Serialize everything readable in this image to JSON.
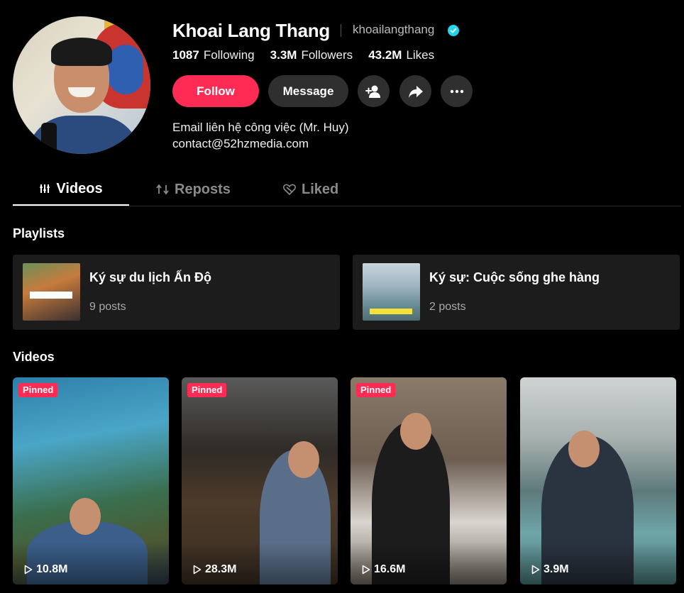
{
  "profile": {
    "name": "Khoai Lang Thang",
    "handle": "khoailangthang",
    "verified": true,
    "stats": [
      {
        "value": "1087",
        "label": "Following"
      },
      {
        "value": "3.3M",
        "label": "Followers"
      },
      {
        "value": "43.2M",
        "label": "Likes"
      }
    ],
    "bio_line1": "Email liên hệ công việc (Mr. Huy)",
    "bio_line2": "contact@52hzmedia.com"
  },
  "actions": {
    "follow_label": "Follow",
    "message_label": "Message"
  },
  "tabs": [
    {
      "label": "Videos",
      "active": true
    },
    {
      "label": "Reposts",
      "active": false
    },
    {
      "label": "Liked",
      "active": false
    }
  ],
  "sections": {
    "playlists_title": "Playlists",
    "videos_title": "Videos"
  },
  "playlists": [
    {
      "title": "Ký sự du lịch Ấn Độ",
      "count": "9 posts"
    },
    {
      "title": "Ký sự: Cuộc sống ghe hàng",
      "count": "2 posts"
    }
  ],
  "videos": [
    {
      "pinned_label": "Pinned",
      "views": "10.8M"
    },
    {
      "pinned_label": "Pinned",
      "views": "28.3M"
    },
    {
      "pinned_label": "Pinned",
      "views": "16.6M"
    },
    {
      "pinned_label": "",
      "views": "3.9M"
    }
  ],
  "colors": {
    "accent": "#fe2c55",
    "verified": "#20d5ec",
    "background": "#000000",
    "card": "#1c1c1c"
  },
  "icons": [
    "verified-icon",
    "add-friend-icon",
    "share-icon",
    "more-icon",
    "videos-tab-icon",
    "reposts-icon",
    "liked-icon",
    "play-icon"
  ]
}
